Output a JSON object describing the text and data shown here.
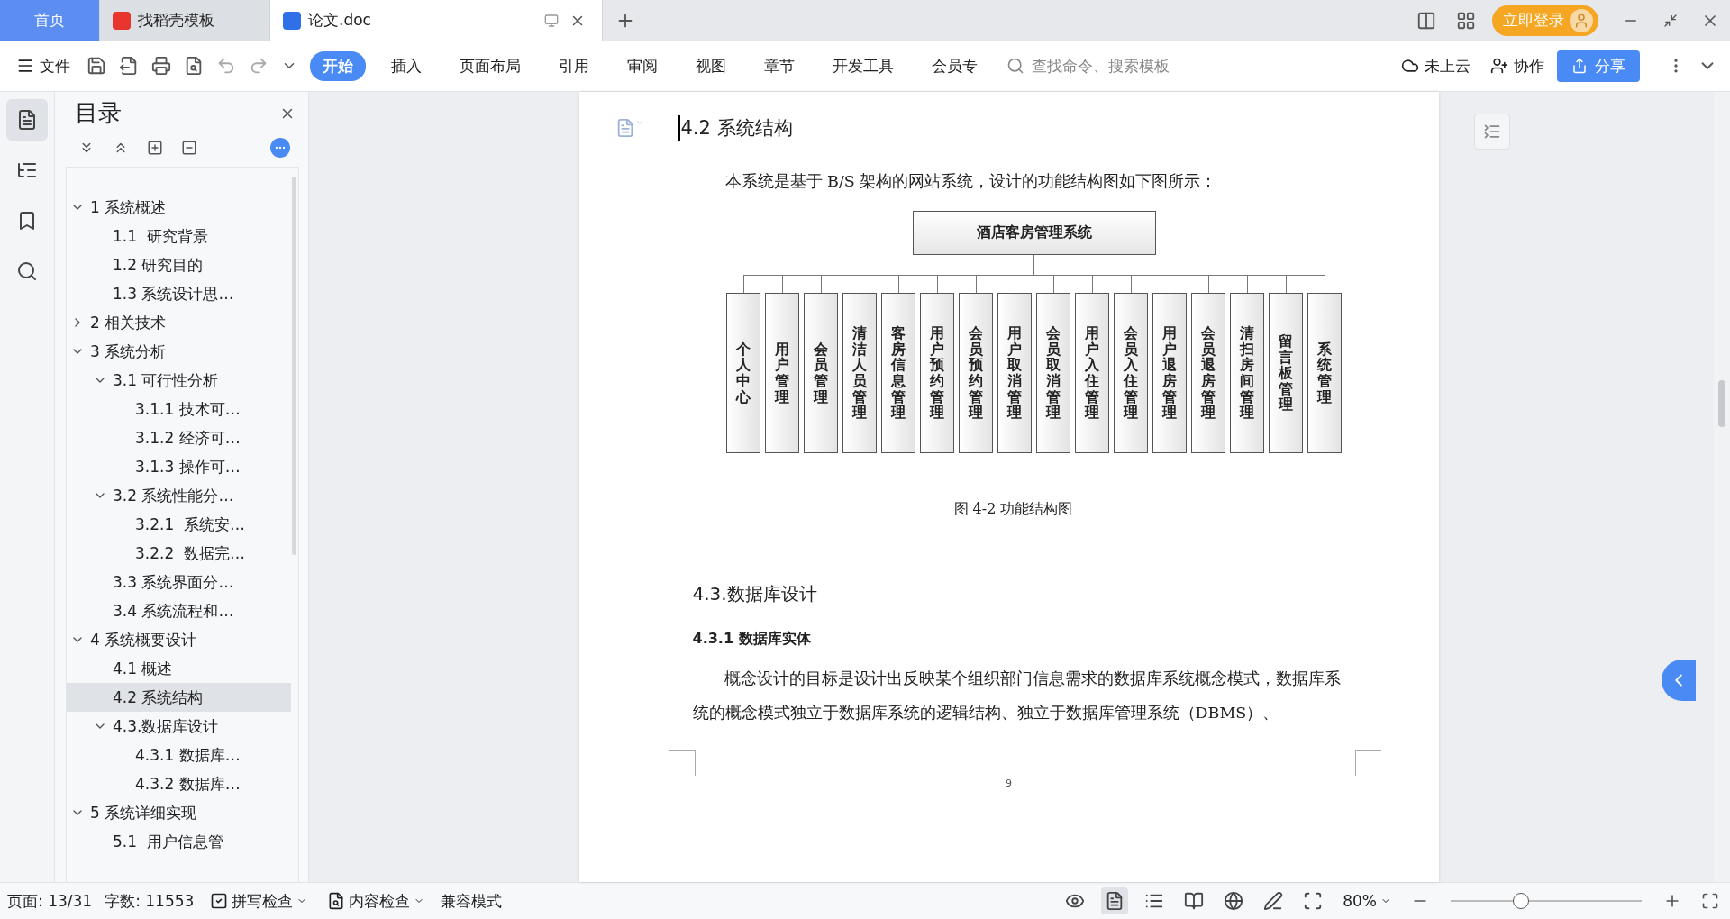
{
  "tabs": [
    {
      "label": "首页",
      "kind": "home",
      "selected": false
    },
    {
      "label": "找稻壳模板",
      "kind": "docer",
      "selected": false
    },
    {
      "label": "论文.doc",
      "kind": "doc",
      "selected": true
    }
  ],
  "login_button": "立即登录",
  "file_menu": "文件",
  "ribbon_tabs": [
    {
      "label": "开始",
      "selected": true
    },
    {
      "label": "插入",
      "selected": false
    },
    {
      "label": "页面布局",
      "selected": false
    },
    {
      "label": "引用",
      "selected": false
    },
    {
      "label": "审阅",
      "selected": false
    },
    {
      "label": "视图",
      "selected": false
    },
    {
      "label": "章节",
      "selected": false
    },
    {
      "label": "开发工具",
      "selected": false
    },
    {
      "label": "会员专",
      "selected": false
    }
  ],
  "search": {
    "placeholder": "查找命令、搜索模板"
  },
  "cloud": "未上云",
  "collab": "协作",
  "share": "分享",
  "sidebar": {
    "title": "目录",
    "items": [
      {
        "label": "1 系统概述",
        "expanded": true,
        "selected": false,
        "children": [
          {
            "label": "1.1  研究背景",
            "selected": false
          },
          {
            "label": "1.2 研究目的",
            "selected": false
          },
          {
            "label": "1.3 系统设计思…",
            "selected": false
          }
        ]
      },
      {
        "label": "2 相关技术",
        "expanded": false,
        "selected": false
      },
      {
        "label": "3 系统分析",
        "expanded": true,
        "selected": false,
        "children": [
          {
            "label": "3.1 可行性分析",
            "expanded": true,
            "selected": false,
            "children": [
              {
                "label": "3.1.1 技术可…",
                "selected": false
              },
              {
                "label": "3.1.2 经济可…",
                "selected": false
              },
              {
                "label": "3.1.3 操作可…",
                "selected": false
              }
            ]
          },
          {
            "label": "3.2 系统性能分…",
            "expanded": true,
            "selected": false,
            "children": [
              {
                "label": "3.2.1  系统安…",
                "selected": false
              },
              {
                "label": "3.2.2  数据完…",
                "selected": false
              }
            ]
          },
          {
            "label": "3.3 系统界面分…",
            "selected": false
          },
          {
            "label": "3.4 系统流程和…",
            "selected": false
          }
        ]
      },
      {
        "label": "4 系统概要设计",
        "expanded": true,
        "selected": false,
        "children": [
          {
            "label": "4.1 概述",
            "selected": false
          },
          {
            "label": "4.2 系统结构",
            "selected": true
          },
          {
            "label": "4.3.数据库设计",
            "expanded": true,
            "selected": false,
            "children": [
              {
                "label": "4.3.1 数据库…",
                "selected": false
              },
              {
                "label": "4.3.2 数据库…",
                "selected": false
              }
            ]
          }
        ]
      },
      {
        "label": "5 系统详细实现",
        "expanded": true,
        "selected": false,
        "children": [
          {
            "label": "5.1  用户信息管",
            "selected": false
          }
        ]
      }
    ]
  },
  "document": {
    "heading": "4.2 系统结构",
    "intro": "本系统是基于 B/S 架构的网站系统，设计的功能结构图如下图所示：",
    "chart": {
      "root": "酒店客房管理系统",
      "nodes": [
        "个人中心",
        "用户管理",
        "会员管理",
        "清洁人员管理",
        "客房信息管理",
        "用户预约管理",
        "会员预约管理",
        "用户取消管理",
        "会员取消管理",
        "用户入住管理",
        "会员入住管理",
        "用户退房管理",
        "会员退房管理",
        "清扫房间管理",
        "留言板管理",
        "系统管理"
      ]
    },
    "caption": "图 4-2 功能结构图",
    "section_heading": "4.3.数据库设计",
    "subheading": "4.3.1 数据库实体",
    "paragraph": "概念设计的目标是设计出反映某个组织部门信息需求的数据库系统概念模式，数据库系统的概念模式独立于数据库系统的逻辑结构、独立于数据库管理系统（DBMS）、",
    "page_number": "9"
  },
  "status_bar": {
    "page": "页面: 13/31",
    "words": "字数: 11553",
    "spell_check": "拼写检查",
    "content_check": "内容检查",
    "mode": "兼容模式",
    "zoom": "80%",
    "zoom_slider": {
      "level": 0.37
    }
  }
}
